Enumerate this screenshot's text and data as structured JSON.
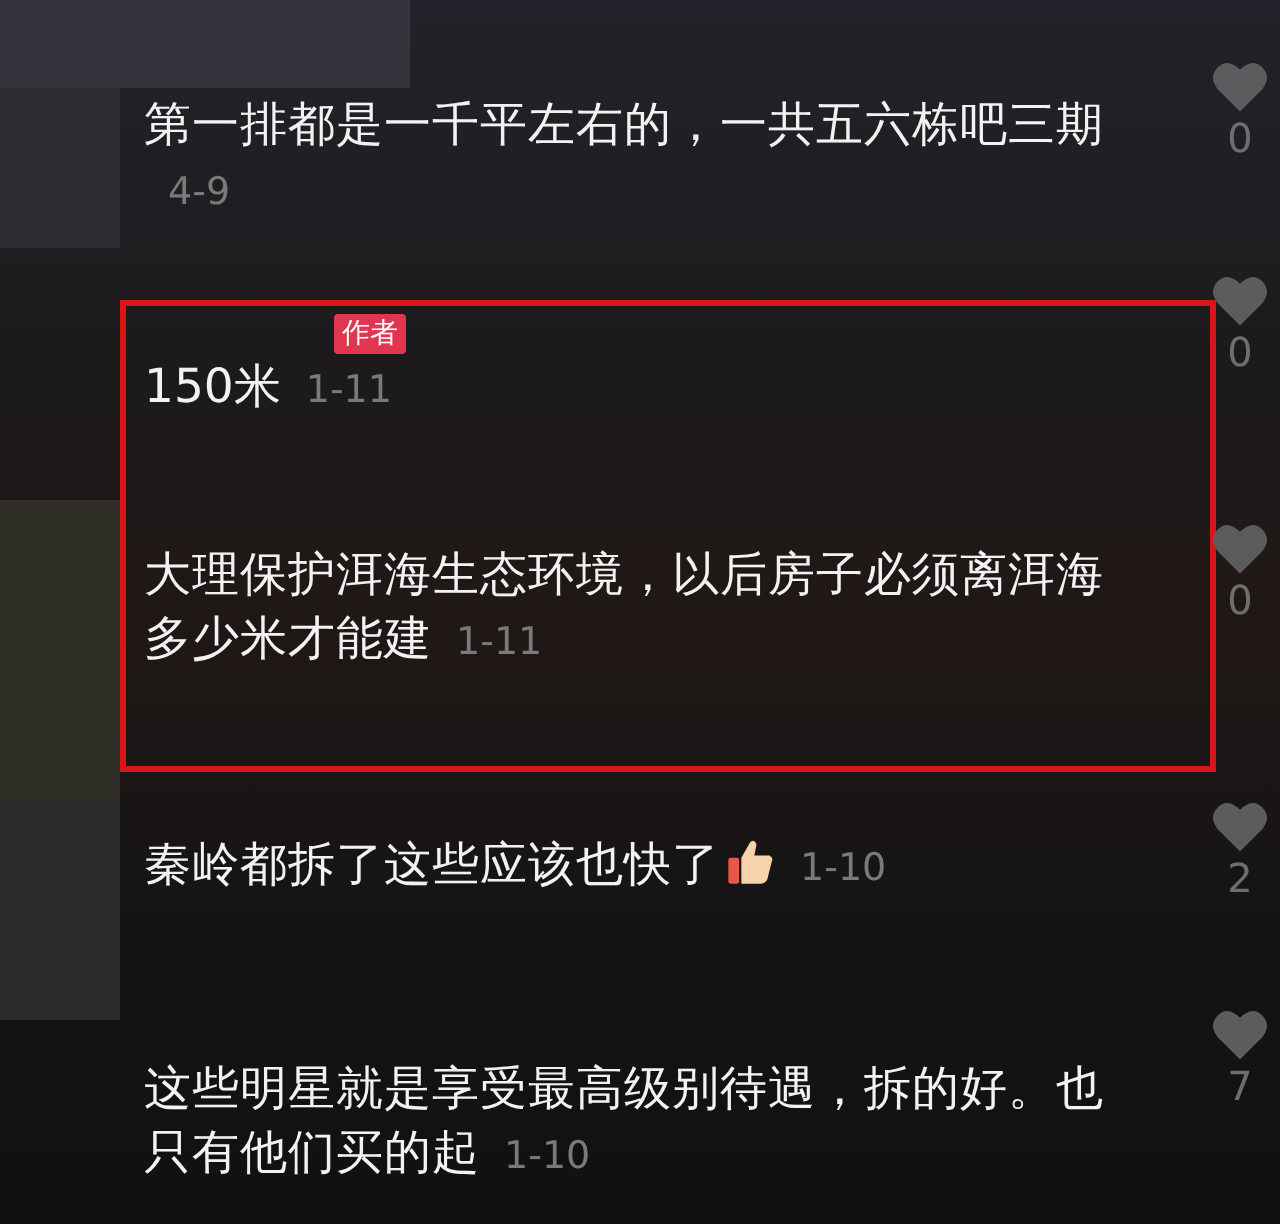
{
  "sections": [
    {
      "highlighted": false,
      "comments": [
        {
          "text": "第一排都是一千平左右的，一共五六栋吧三期",
          "date": "4-9",
          "likes": "0"
        }
      ]
    },
    {
      "highlighted": true,
      "comments": [
        {
          "badge": "作者",
          "text": "150米",
          "date": "1-11",
          "likes": "0"
        },
        {
          "text": "大理保护洱海生态环境，以后房子必须离洱海多少米才能建",
          "date": "1-11",
          "likes": "0"
        }
      ]
    },
    {
      "highlighted": false,
      "comments": [
        {
          "text": "秦岭都拆了这些应该也快了",
          "thumbs_up": true,
          "date": "1-10",
          "likes": "2"
        },
        {
          "text": "这些明星就是享受最高级别待遇，拆的好。也只有他们买的起",
          "date": "1-10",
          "likes": "7"
        }
      ]
    }
  ]
}
